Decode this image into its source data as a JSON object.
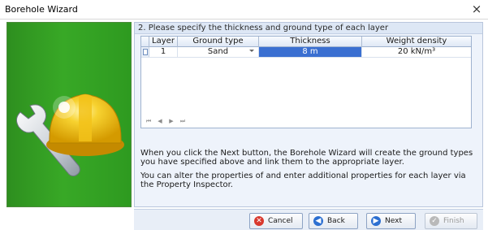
{
  "window": {
    "title": "Borehole Wizard",
    "close_glyph": "×"
  },
  "section": {
    "header": "2. Please specify the thickness and ground type of each layer"
  },
  "table": {
    "columns": [
      "Layer",
      "Ground type",
      "Thickness",
      "Weight density"
    ],
    "rows": [
      {
        "layer": "1",
        "ground_type": "Sand",
        "thickness": "8 m",
        "weight_density": "20 kN/m³"
      }
    ],
    "navigator": [
      "⏮",
      "◀",
      "▶",
      "⏭"
    ]
  },
  "info": {
    "paragraph1": "When you click the Next button, the Borehole Wizard will create the ground types you have specified above and link them to the appropriate layer.",
    "paragraph2": "You can alter the properties of and enter additional properties for each layer via the Property Inspector."
  },
  "buttons": {
    "cancel": "Cancel",
    "back": "Back",
    "next": "Next",
    "finish": "Finish"
  },
  "icons": {
    "wizard": "hardhat-wrench-icon",
    "cancel": "cancel-icon",
    "back": "back-arrow-icon",
    "next": "next-arrow-icon",
    "finish": "finish-icon"
  },
  "colors": {
    "selection": "#3a6fd1",
    "panel_green": "#38a826",
    "helmet_yellow": "#f5c518"
  }
}
